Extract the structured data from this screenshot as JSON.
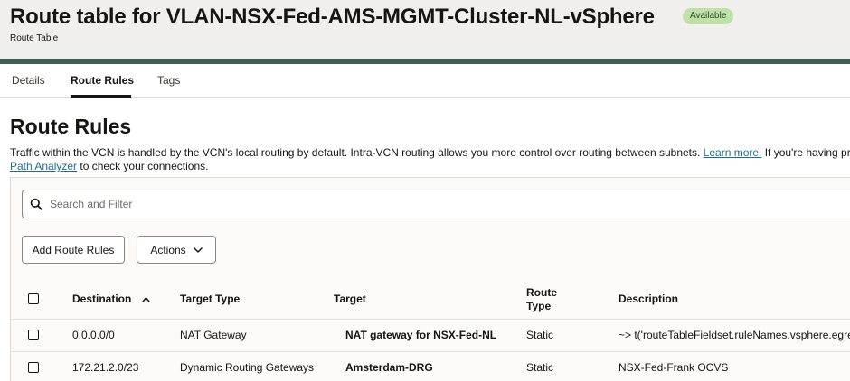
{
  "header": {
    "title": "Route table for VLAN-NSX-Fed-AMS-MGMT-Cluster-NL-vSphere",
    "status_badge": "Available",
    "subtitle": "Route Table"
  },
  "tabs": [
    {
      "label": "Details",
      "active": false
    },
    {
      "label": "Route Rules",
      "active": true
    },
    {
      "label": "Tags",
      "active": false
    }
  ],
  "section": {
    "title": "Route Rules",
    "description_part1": "Traffic within the VCN is handled by the VCN's local routing by default. Intra-VCN routing allows you more control over routing between subnets. ",
    "learn_more": "Learn more.",
    "description_part2": " If you're having pr",
    "path_analyzer": "Path Analyzer",
    "description_part3": " to check your connections."
  },
  "search": {
    "placeholder": "Search and Filter",
    "value": ""
  },
  "toolbar": {
    "add_label": "Add Route Rules",
    "actions_label": "Actions"
  },
  "table": {
    "columns": {
      "destination": "Destination",
      "target_type": "Target Type",
      "target": "Target",
      "route_type_line1": "Route",
      "route_type_line2": "Type",
      "description": "Description"
    },
    "sort_column": "Destination",
    "sort_direction": "ascending",
    "rows": [
      {
        "destination": "0.0.0.0/0",
        "target_type": "NAT Gateway",
        "target": "NAT gateway for NSX-Fed-NL",
        "route_type": "Static",
        "description": "~> t('routeTableFieldset.ruleNames.vsphere.egre"
      },
      {
        "destination": "172.21.2.0/23",
        "target_type": "Dynamic Routing Gateways",
        "target": "Amsterdam-DRG",
        "route_type": "Static",
        "description": "NSX-Fed-Frank OCVS"
      }
    ]
  },
  "colors": {
    "header_bg": "#f1efed",
    "badge_bg": "#bfe0a9",
    "link": "#1f6f8b",
    "banner": "#3f5f52"
  }
}
